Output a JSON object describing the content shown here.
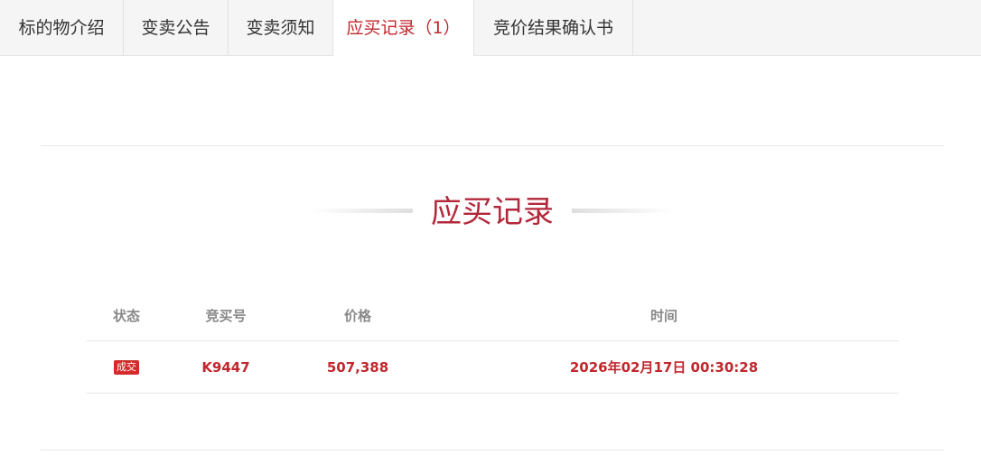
{
  "tabs": [
    {
      "label": "标的物介绍"
    },
    {
      "label": "变卖公告"
    },
    {
      "label": "变卖须知"
    },
    {
      "label": "应买记录（1）"
    },
    {
      "label": "竞价结果确认书"
    }
  ],
  "section": {
    "title": "应买记录"
  },
  "table": {
    "headers": {
      "status": "状态",
      "code": "竞买号",
      "price": "价格",
      "time": "时间"
    },
    "rows": [
      {
        "status": "成交",
        "code": "K9447",
        "price": "507,388",
        "time": "2026年02月17日 00:30:28"
      }
    ]
  },
  "colors": {
    "accent": "#c1272d",
    "title": "#b3283b",
    "badge": "#d42a2a"
  }
}
